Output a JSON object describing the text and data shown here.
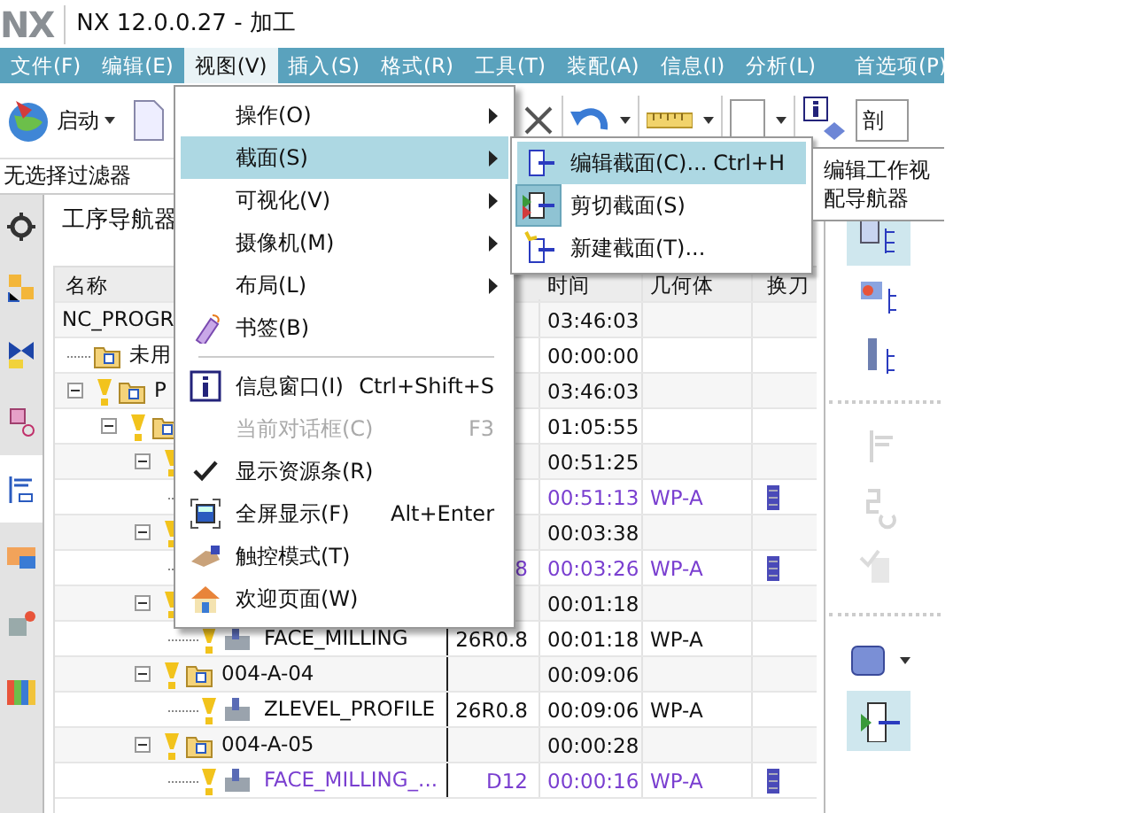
{
  "window": {
    "logo": "NX",
    "title": "NX 12.0.0.27 - 加工"
  },
  "menu_bar": [
    {
      "label": "文件(F)",
      "selected": false
    },
    {
      "label": "编辑(E)",
      "selected": false
    },
    {
      "label": "视图(V)",
      "selected": true
    },
    {
      "label": "插入(S)",
      "selected": false
    },
    {
      "label": "格式(R)",
      "selected": false
    },
    {
      "label": "工具(T)",
      "selected": false
    },
    {
      "label": "装配(A)",
      "selected": false
    },
    {
      "label": "信息(I)",
      "selected": false
    },
    {
      "label": "分析(L)",
      "selected": false
    },
    {
      "label": "首选项(P)",
      "selected": false
    }
  ],
  "toolbar": {
    "start_button": "启动",
    "search_field": "剖"
  },
  "filter": "无选择过滤器",
  "resource_bar": [
    {
      "selected": false
    },
    {
      "selected": false
    },
    {
      "selected": false
    },
    {
      "selected": false
    },
    {
      "selected": true
    },
    {
      "selected": false
    },
    {
      "selected": false
    },
    {
      "selected": false
    }
  ],
  "navigator": {
    "title": "工序导航器",
    "columns": {
      "name": "名称",
      "time": "时间",
      "geometry": "几何体",
      "tool_change": "换刀"
    },
    "tree": [
      {
        "name": "NC_PROGR",
        "time": "03:46:03",
        "children": [
          {
            "kind": "folder",
            "name": "未用",
            "time": "00:00:00"
          },
          {
            "kind": "folder",
            "name": "P",
            "time": "03:46:03",
            "expanded": true,
            "children": [
              {
                "kind": "folder",
                "time": "01:05:55",
                "expanded": true,
                "children": [
                  {
                    "time": "00:51:25",
                    "expanded": true,
                    "children": [
                      {
                        "kind": "operation",
                        "time": "00:51:13",
                        "geometry": "WP-A",
                        "tool_change": true,
                        "color": "#7a3fd0"
                      }
                    ]
                  },
                  {
                    "time": "00:03:38",
                    "expanded": true,
                    "children": [
                      {
                        "kind": "operation",
                        "column_2": "8",
                        "time": "00:03:26",
                        "geometry": "WP-A",
                        "tool_change": true,
                        "color": "#7a3fd0"
                      }
                    ]
                  },
                  {
                    "time": "00:01:18",
                    "expanded": true,
                    "children": [
                      {
                        "kind": "operation",
                        "name": "FACE_MILLING",
                        "column_2": "26R0.8",
                        "time": "00:01:18",
                        "geometry": "WP-A",
                        "tool_change": false,
                        "color": "#111111"
                      }
                    ]
                  },
                  {
                    "kind": "folder",
                    "name": "004-A-04",
                    "time": "00:09:06",
                    "expanded": true,
                    "children": [
                      {
                        "kind": "operation",
                        "name": "ZLEVEL_PROFILE",
                        "column_2": "26R0.8",
                        "time": "00:09:06",
                        "geometry": "WP-A",
                        "tool_change": false,
                        "color": "#111111"
                      }
                    ]
                  },
                  {
                    "kind": "folder",
                    "name": "004-A-05",
                    "time": "00:00:28",
                    "expanded": true,
                    "children": [
                      {
                        "kind": "operation",
                        "name": "FACE_MILLING_...",
                        "column_2": "D12",
                        "time": "00:00:16",
                        "geometry": "WP-A",
                        "tool_change": true,
                        "color": "#7a3fd0"
                      }
                    ]
                  }
                ]
              }
            ]
          }
        ]
      }
    ]
  },
  "right_bar": [
    {
      "selected": true,
      "disabled": false
    },
    {
      "selected": false,
      "disabled": false
    },
    {
      "selected": false,
      "disabled": false
    },
    {
      "selected": false,
      "disabled": true
    },
    {
      "selected": false,
      "disabled": true
    },
    {
      "selected": false,
      "disabled": true
    },
    {
      "selected": false,
      "disabled": false
    },
    {
      "selected": true,
      "disabled": false
    }
  ],
  "view_menu": [
    {
      "kind": "submenu",
      "label": "操作(O)",
      "selected": false
    },
    {
      "kind": "submenu",
      "label": "截面(S)",
      "selected": true
    },
    {
      "kind": "submenu",
      "label": "可视化(V)",
      "selected": false
    },
    {
      "kind": "submenu",
      "label": "摄像机(M)",
      "selected": false
    },
    {
      "kind": "submenu",
      "label": "布局(L)",
      "selected": false
    },
    {
      "kind": "command",
      "label": "书签(B)",
      "disabled": false,
      "checked": false
    },
    {
      "kind": "separator"
    },
    {
      "kind": "command",
      "label": "信息窗口(I)",
      "shortcut": "Ctrl+Shift+S",
      "disabled": false,
      "checked": false
    },
    {
      "kind": "command",
      "label": "当前对话框(C)",
      "shortcut": "F3",
      "disabled": true,
      "checked": false
    },
    {
      "kind": "command",
      "label": "显示资源条(R)",
      "disabled": false,
      "checked": true
    },
    {
      "kind": "command",
      "label": "全屏显示(F)",
      "shortcut": "Alt+Enter",
      "disabled": false,
      "checked": false
    },
    {
      "kind": "command",
      "label": "触控模式(T)",
      "disabled": false,
      "checked": false
    },
    {
      "kind": "command",
      "label": "欢迎页面(W)",
      "disabled": false,
      "checked": false
    }
  ],
  "section_submenu": [
    {
      "label": "编辑截面(C)...",
      "shortcut": "Ctrl+H",
      "selected": true,
      "checked": false
    },
    {
      "label": "剪切截面(S)",
      "selected": false,
      "checked": true
    },
    {
      "label": "新建截面(T)...",
      "selected": false,
      "checked": false
    }
  ],
  "tooltip": [
    "编辑工作视",
    "配导航器"
  ]
}
